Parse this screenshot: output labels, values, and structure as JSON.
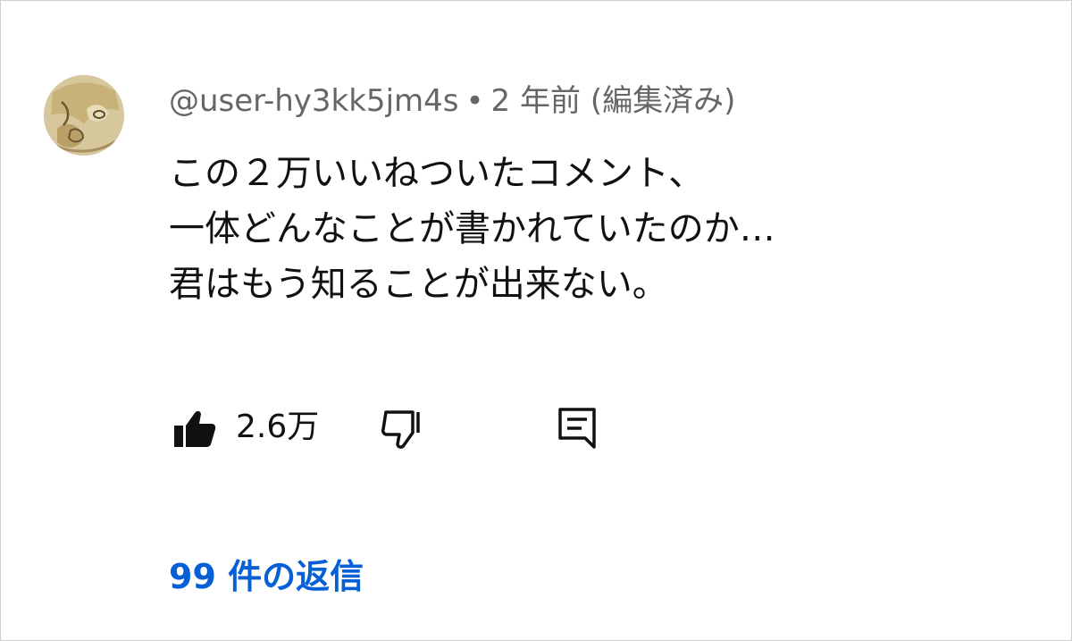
{
  "comment": {
    "author": "@user-hy3kk5jm4s",
    "separator": "•",
    "timestamp": "2 年前",
    "edited_label": "(編集済み)",
    "text_lines": [
      "この２万いいねついたコメント、",
      "一体どんなことが書かれていたのか…",
      "君はもう知ることが出来ない。"
    ],
    "like_count": "2.6万",
    "replies_label": "99 件の返信"
  },
  "icons": {
    "avatar": "user-avatar",
    "like": "thumbs-up-icon",
    "dislike": "thumbs-down-icon",
    "reply": "reply-comment-icon"
  },
  "colors": {
    "link": "#065fd4",
    "meta_text": "#666666",
    "body_text": "#111111"
  }
}
